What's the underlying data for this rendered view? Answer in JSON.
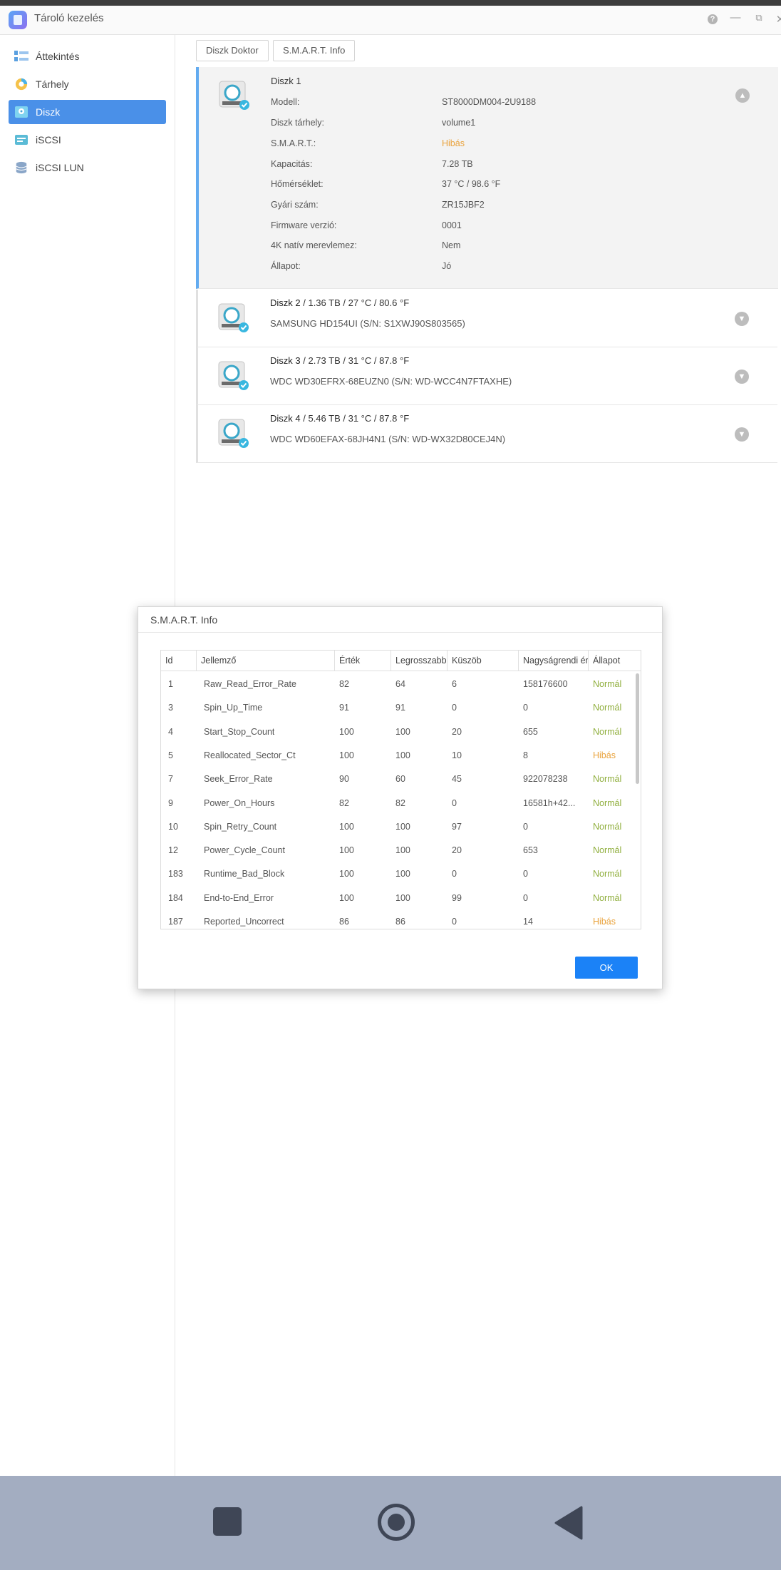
{
  "app": {
    "title": "Tároló kezelés",
    "help_icon": "question-icon",
    "accent": "#4a90e8"
  },
  "sidebar": {
    "items": [
      {
        "label": "Áttekintés",
        "icon": "overview-icon",
        "active": false
      },
      {
        "label": "Tárhely",
        "icon": "storage-pie-icon",
        "active": false
      },
      {
        "label": "Diszk",
        "icon": "disk-icon",
        "active": true
      },
      {
        "label": "iSCSI",
        "icon": "iscsi-icon",
        "active": false
      },
      {
        "label": "iSCSI LUN",
        "icon": "database-icon",
        "active": false
      }
    ]
  },
  "toolbar": {
    "disk_doctor": "Diszk Doktor",
    "smart_info": "S.M.A.R.T. Info"
  },
  "disks": {
    "d1": {
      "title": "Diszk 1",
      "details": [
        {
          "label": "Modell:",
          "value": "ST8000DM004-2U9188"
        },
        {
          "label": "Diszk tárhely:",
          "value": "volume1"
        },
        {
          "label": "S.M.A.R.T.:",
          "value": "Hibás"
        },
        {
          "label": "Kapacitás:",
          "value": "7.28 TB"
        },
        {
          "label": "Hőmérséklet:",
          "value": "37 °C / 98.6 °F"
        },
        {
          "label": "Gyári szám:",
          "value": "ZR15JBF2"
        },
        {
          "label": "Firmware verzió:",
          "value": "0001"
        },
        {
          "label": "4K natív merevlemez:",
          "value": "Nem"
        },
        {
          "label": "Állapot:",
          "value": "Jó"
        }
      ]
    },
    "d2": {
      "name": "Diszk 2",
      "stats": " / 1.36 TB / 27 °C / 80.6 °F",
      "model": "SAMSUNG HD154UI (S/N: S1XWJ90S803565)"
    },
    "d3": {
      "name": "Diszk 3",
      "stats": " / 2.73 TB / 31 °C / 87.8 °F",
      "model": "WDC WD30EFRX-68EUZN0 (S/N: WD-WCC4N7FTAXHE)"
    },
    "d4": {
      "name": "Diszk 4",
      "stats": " / 5.46 TB / 31 °C / 87.8 °F",
      "model": "WDC WD60EFAX-68JH4N1 (S/N: WD-WX32D80CEJ4N)"
    }
  },
  "smart_dialog": {
    "title": "S.M.A.R.T. Info",
    "columns": [
      "Id",
      "Jellemző",
      "Érték",
      "Legrosszabb",
      "Küszöb",
      "Nagyságrendi érték",
      "Állapot"
    ],
    "rows": [
      [
        "1",
        "Raw_Read_Error_Rate",
        "82",
        "64",
        "6",
        "158176600",
        "Normál"
      ],
      [
        "3",
        "Spin_Up_Time",
        "91",
        "91",
        "0",
        "0",
        "Normál"
      ],
      [
        "4",
        "Start_Stop_Count",
        "100",
        "100",
        "20",
        "655",
        "Normál"
      ],
      [
        "5",
        "Reallocated_Sector_Ct",
        "100",
        "100",
        "10",
        "8",
        "Hibás"
      ],
      [
        "7",
        "Seek_Error_Rate",
        "90",
        "60",
        "45",
        "922078238",
        "Normál"
      ],
      [
        "9",
        "Power_On_Hours",
        "82",
        "82",
        "0",
        "16581h+42...",
        "Normál"
      ],
      [
        "10",
        "Spin_Retry_Count",
        "100",
        "100",
        "97",
        "0",
        "Normál"
      ],
      [
        "12",
        "Power_Cycle_Count",
        "100",
        "100",
        "20",
        "653",
        "Normál"
      ],
      [
        "183",
        "Runtime_Bad_Block",
        "100",
        "100",
        "0",
        "0",
        "Normál"
      ],
      [
        "184",
        "End-to-End_Error",
        "100",
        "100",
        "99",
        "0",
        "Normál"
      ],
      [
        "187",
        "Reported_Uncorrect",
        "86",
        "86",
        "0",
        "14",
        "Hibás"
      ]
    ],
    "ok_label": "OK"
  },
  "colors": {
    "normal": "#8fae3c",
    "error": "#e9a23b",
    "ok_button": "#1b82f7",
    "android_nav": "#a3adc1"
  }
}
